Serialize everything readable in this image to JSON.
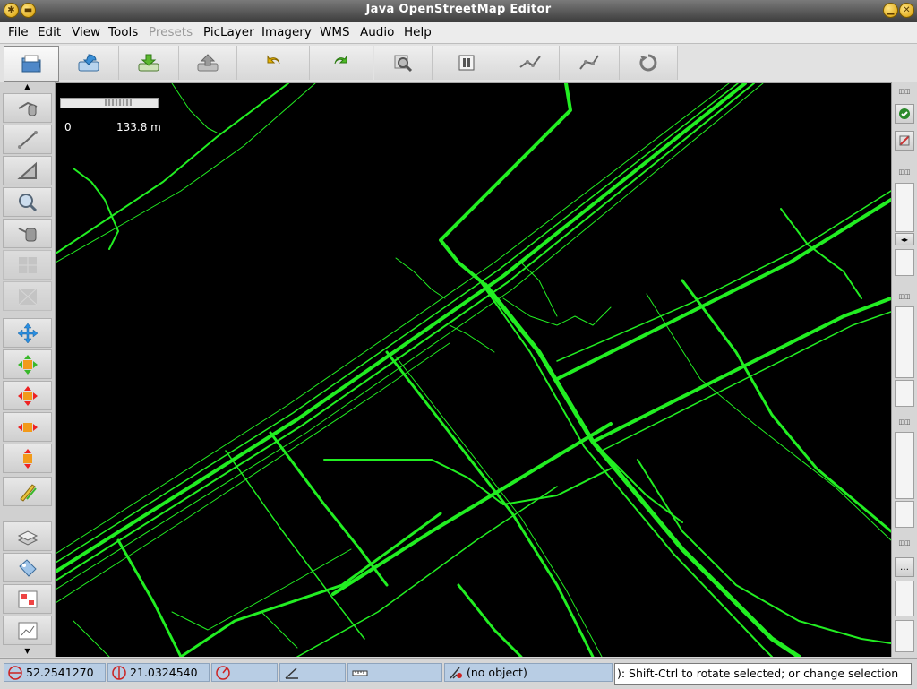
{
  "window": {
    "title": "Java OpenStreetMap Editor"
  },
  "menu": [
    {
      "label": "File",
      "enabled": true
    },
    {
      "label": "Edit",
      "enabled": true
    },
    {
      "label": "View",
      "enabled": true
    },
    {
      "label": "Tools",
      "enabled": true
    },
    {
      "label": "Presets",
      "enabled": false
    },
    {
      "label": "PicLayer",
      "enabled": true
    },
    {
      "label": "Imagery",
      "enabled": true
    },
    {
      "label": "WMS",
      "enabled": true
    },
    {
      "label": "Audio",
      "enabled": true
    },
    {
      "label": "Help",
      "enabled": true
    }
  ],
  "toolbar": [
    {
      "icon": "open-file-icon"
    },
    {
      "icon": "download-icon"
    },
    {
      "icon": "save-icon"
    },
    {
      "icon": "upload-icon"
    },
    {
      "icon": "undo-icon"
    },
    {
      "icon": "redo-icon"
    },
    {
      "icon": "zoom-selection-icon"
    },
    {
      "icon": "preferences-icon"
    },
    {
      "icon": "split-way-icon"
    },
    {
      "icon": "combine-way-icon"
    },
    {
      "icon": "refresh-icon"
    }
  ],
  "left_tools": [
    {
      "icon": "select-mode-icon"
    },
    {
      "icon": "draw-way-icon"
    },
    {
      "icon": "draw-area-icon"
    },
    {
      "icon": "zoom-mode-icon"
    },
    {
      "icon": "delete-mode-icon"
    },
    {
      "icon": "disabled-tool-icon"
    },
    {
      "icon": "disabled-tool-icon"
    },
    {
      "icon": "move-icon"
    },
    {
      "icon": "rotate-icon"
    },
    {
      "icon": "scale-icon"
    },
    {
      "icon": "move-horizontal-icon"
    },
    {
      "icon": "move-vertical-icon"
    },
    {
      "icon": "pencil-icon"
    },
    {
      "icon": "layers-icon"
    },
    {
      "icon": "tags-icon"
    },
    {
      "icon": "relations-icon"
    },
    {
      "icon": "history-icon"
    }
  ],
  "scale": {
    "start": "0",
    "end": "133.8 m"
  },
  "status": {
    "lat": "52.2541270",
    "lon": "21.0324540",
    "heading": "",
    "angle": "",
    "distance": "",
    "object": "(no object)",
    "help": "): Shift-Ctrl to rotate selected; or change selection"
  },
  "colors": {
    "track": "#22ee22",
    "map_bg": "#000000",
    "status_field": "#b8cde4"
  }
}
